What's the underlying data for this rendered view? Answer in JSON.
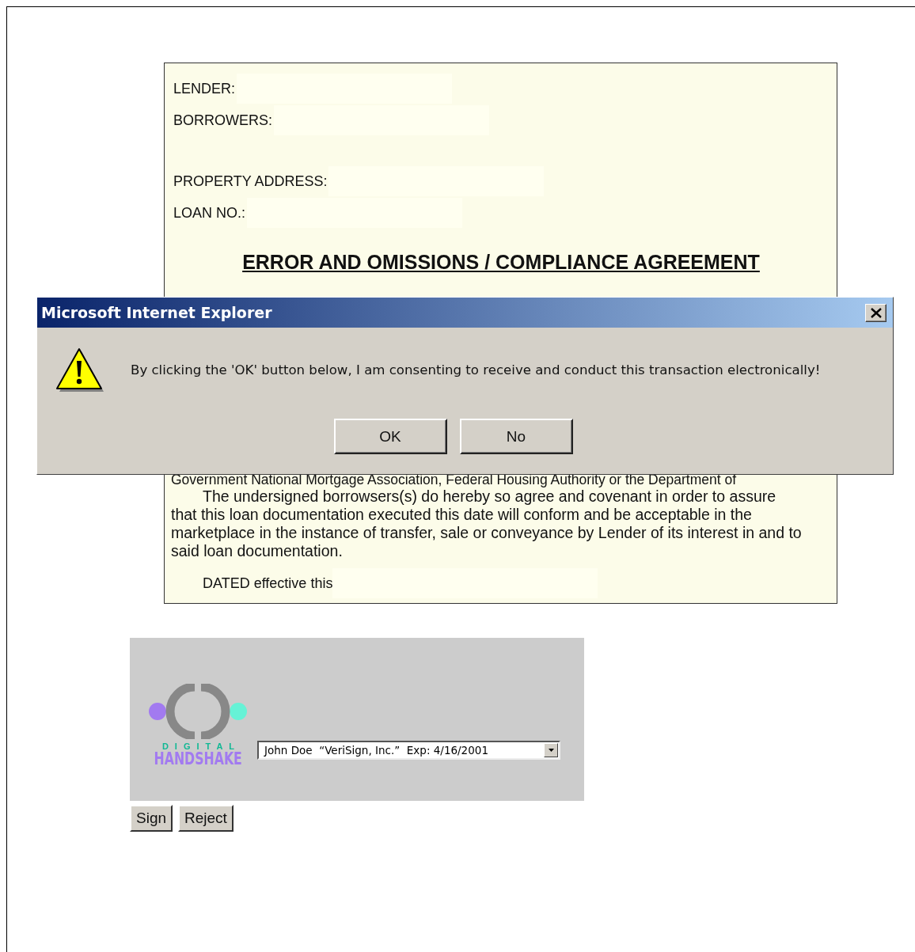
{
  "document": {
    "field_groups": [
      {
        "labels": [
          "LENDER:",
          "BORROWERS:"
        ]
      },
      {
        "labels": [
          "PROPERTY ADDRESS:",
          "LOAN NO.:"
        ]
      }
    ],
    "title": "ERROR AND OMISSIONS / COMPLIANCE AGREEMENT",
    "partial_line": "Government National Mortgage Association, Federal Housing Authority or the Department of",
    "paragraph": "The undersigned borrowsers(s) do hereby so agree and covenant in order to assure that this loan documentation executed this date will conform and be acceptable in the marketplace in the instance of transfer, sale or conveyance by Lender of its interest in and to said loan documentation.",
    "dated": "DATED effective this"
  },
  "dialog": {
    "title": "Microsoft Internet Explorer",
    "message": "By clicking the 'OK' button below, I am consenting to receive and conduct this transaction electronically!",
    "buttons": [
      "OK",
      "No"
    ]
  },
  "signing": {
    "logo_top": "DIGITAL",
    "logo_bottom": "HANDSHAKE",
    "certificate": "John Doe  “VeriSign, Inc.”  Exp: 4/16/2001",
    "buttons": [
      "Sign",
      "Reject"
    ]
  }
}
